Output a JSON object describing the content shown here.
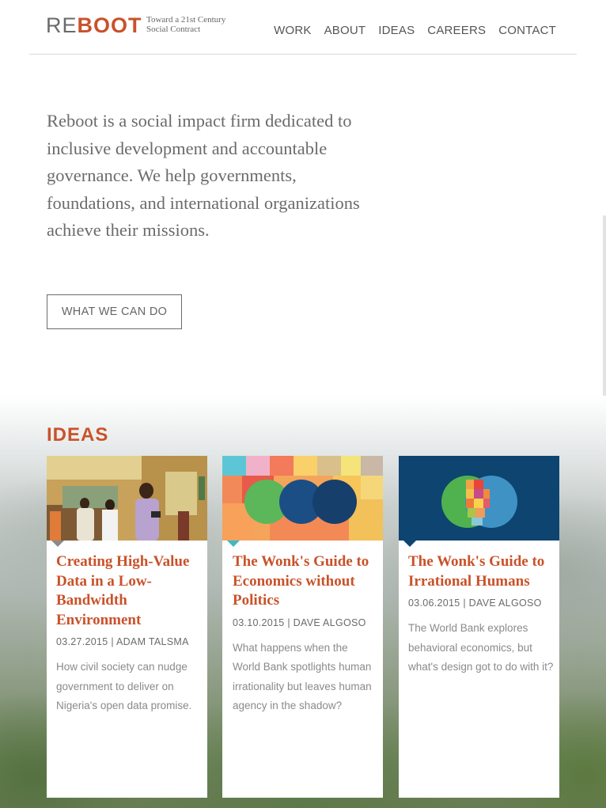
{
  "header": {
    "logo": {
      "re": "RE",
      "boot": "BOOT"
    },
    "tagline": [
      "Toward a 21st Century",
      "Social Contract"
    ],
    "nav": [
      "WORK",
      "ABOUT",
      "IDEAS",
      "CAREERS",
      "CONTACT"
    ]
  },
  "hero": {
    "text": "Reboot is a social impact firm dedicated to inclusive development and accountable governance. We help governments, foundations, and international organizations achieve their missions.",
    "cta_label": "WHAT WE CAN DO"
  },
  "ideas": {
    "title": "IDEAS",
    "cards": [
      {
        "title": "Creating High-Value Data in a Low-Bandwidth Environment",
        "meta": "03.27.2015 | ADAM TALSMA",
        "excerpt": "How civil society can nudge government to deliver on Nigeria's open data promise."
      },
      {
        "title": "The Wonk's Guide to Economics without Politics",
        "meta": "03.10.2015 | DAVE ALGOSO",
        "excerpt": "What happens when the World Bank spotlights human irrationality but leaves human agency in the shadow?"
      },
      {
        "title": "The Wonk's Guide to Irrational Humans",
        "meta": "03.06.2015 | DAVE ALGOSO",
        "excerpt": "The World Bank explores behavioral economics, but what's design got to do with it?"
      }
    ]
  },
  "colors": {
    "accent": "#c9522a",
    "text": "#6b6b6b",
    "navy": "#0d4470"
  }
}
